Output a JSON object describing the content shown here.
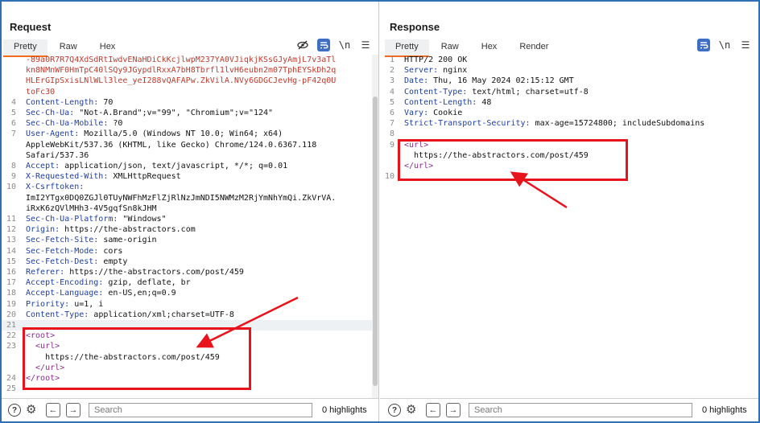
{
  "request": {
    "title": "Request",
    "tabs": [
      "Pretty",
      "Raw",
      "Hex"
    ],
    "active_tab": "Pretty",
    "toolbar_icons": [
      "eye-slash-icon",
      "wrap-lines-icon",
      "newline-icon",
      "menu-icon"
    ],
    "lines": [
      {
        "n": "",
        "parts": [
          {
            "t": "-89a0R7R7Q4XdSdRtIwdvENaHDiCkKcjlwpM237YA0VJiqkjKSsGJyAmjL7v3aTl",
            "c": "red"
          }
        ]
      },
      {
        "n": "",
        "parts": [
          {
            "t": "kn8NMnWF0HmTpC40lSQy9JGypdlRxxA7bH8Tbrfl1lvH6eubn2m07TphEYSkDh2q",
            "c": "red"
          }
        ]
      },
      {
        "n": "",
        "parts": [
          {
            "t": "HLErGIpSxisLNlWLl3lee_yeI288vQAFAPw.ZkVilA.NVy6GDGCJevHg-pF42q0U",
            "c": "red"
          }
        ]
      },
      {
        "n": "",
        "parts": [
          {
            "t": "toFc30",
            "c": "red"
          }
        ]
      },
      {
        "n": "4",
        "parts": [
          {
            "t": "Content-Length:",
            "c": "hn"
          },
          {
            "t": " 70",
            "c": ""
          }
        ]
      },
      {
        "n": "5",
        "parts": [
          {
            "t": "Sec-Ch-Ua:",
            "c": "hn"
          },
          {
            "t": " \"Not-A.Brand\";v=\"99\", \"Chromium\";v=\"124\"",
            "c": ""
          }
        ]
      },
      {
        "n": "6",
        "parts": [
          {
            "t": "Sec-Ch-Ua-Mobile:",
            "c": "hn"
          },
          {
            "t": " ?0",
            "c": ""
          }
        ]
      },
      {
        "n": "7",
        "parts": [
          {
            "t": "User-Agent:",
            "c": "hn"
          },
          {
            "t": " Mozilla/5.0 (Windows NT 10.0; Win64; x64)",
            "c": ""
          }
        ]
      },
      {
        "n": "",
        "parts": [
          {
            "t": "AppleWebKit/537.36 (KHTML, like Gecko) Chrome/124.0.6367.118",
            "c": ""
          }
        ]
      },
      {
        "n": "",
        "parts": [
          {
            "t": "Safari/537.36",
            "c": ""
          }
        ]
      },
      {
        "n": "8",
        "parts": [
          {
            "t": "Accept:",
            "c": "hn"
          },
          {
            "t": " application/json, text/javascript, */*; q=0.01",
            "c": ""
          }
        ]
      },
      {
        "n": "9",
        "parts": [
          {
            "t": "X-Requested-With:",
            "c": "hn"
          },
          {
            "t": " XMLHttpRequest",
            "c": ""
          }
        ]
      },
      {
        "n": "10",
        "parts": [
          {
            "t": "X-Csrftoken:",
            "c": "hn"
          }
        ]
      },
      {
        "n": "",
        "parts": [
          {
            "t": "ImI2YTgx0DQ0ZGJl0TUyNWFhMzFlZjRlNzJmNDI5NWMzM2RjYmNhYmQi.ZkVrVA.",
            "c": ""
          }
        ]
      },
      {
        "n": "",
        "parts": [
          {
            "t": "iRxK6zQVlMHh3-4V5gqfSn8kJHM",
            "c": ""
          }
        ]
      },
      {
        "n": "11",
        "parts": [
          {
            "t": "Sec-Ch-Ua-Platform:",
            "c": "hn"
          },
          {
            "t": " \"Windows\"",
            "c": ""
          }
        ]
      },
      {
        "n": "12",
        "parts": [
          {
            "t": "Origin:",
            "c": "hn"
          },
          {
            "t": " https://the-abstractors.com",
            "c": ""
          }
        ]
      },
      {
        "n": "13",
        "parts": [
          {
            "t": "Sec-Fetch-Site:",
            "c": "hn"
          },
          {
            "t": " same-origin",
            "c": ""
          }
        ]
      },
      {
        "n": "14",
        "parts": [
          {
            "t": "Sec-Fetch-Mode:",
            "c": "hn"
          },
          {
            "t": " cors",
            "c": ""
          }
        ]
      },
      {
        "n": "15",
        "parts": [
          {
            "t": "Sec-Fetch-Dest:",
            "c": "hn"
          },
          {
            "t": " empty",
            "c": ""
          }
        ]
      },
      {
        "n": "16",
        "parts": [
          {
            "t": "Referer:",
            "c": "hn"
          },
          {
            "t": " https://the-abstractors.com/post/459",
            "c": ""
          }
        ]
      },
      {
        "n": "17",
        "parts": [
          {
            "t": "Accept-Encoding:",
            "c": "hn"
          },
          {
            "t": " gzip, deflate, br",
            "c": ""
          }
        ]
      },
      {
        "n": "18",
        "parts": [
          {
            "t": "Accept-Language:",
            "c": "hn"
          },
          {
            "t": " en-US,en;q=0.9",
            "c": ""
          }
        ]
      },
      {
        "n": "19",
        "parts": [
          {
            "t": "Priority:",
            "c": "hn"
          },
          {
            "t": " u=1, i",
            "c": ""
          }
        ]
      },
      {
        "n": "20",
        "parts": [
          {
            "t": "Content-Type:",
            "c": "hn"
          },
          {
            "t": " application/xml;charset=UTF-8",
            "c": ""
          }
        ]
      },
      {
        "n": "21",
        "parts": [
          {
            "t": "",
            "c": ""
          }
        ],
        "hl": true
      },
      {
        "n": "22",
        "parts": [
          {
            "t": "<root>",
            "c": "tag"
          }
        ]
      },
      {
        "n": "23",
        "parts": [
          {
            "t": "  <url>",
            "c": "tag"
          }
        ]
      },
      {
        "n": "",
        "parts": [
          {
            "t": "    https://the-abstractors.com/post/459",
            "c": ""
          }
        ]
      },
      {
        "n": "",
        "parts": [
          {
            "t": "  </url>",
            "c": "tag"
          }
        ]
      },
      {
        "n": "24",
        "parts": [
          {
            "t": "</root>",
            "c": "tag"
          }
        ]
      },
      {
        "n": "25",
        "parts": [
          {
            "t": "",
            "c": ""
          }
        ]
      }
    ],
    "search_placeholder": "Search",
    "highlights": "0 highlights"
  },
  "response": {
    "title": "Response",
    "tabs": [
      "Pretty",
      "Raw",
      "Hex",
      "Render"
    ],
    "active_tab": "Pretty",
    "toolbar_icons": [
      "wrap-lines-icon",
      "newline-icon",
      "menu-icon"
    ],
    "lines": [
      {
        "n": "1",
        "parts": [
          {
            "t": "HTTP/2 200 OK",
            "c": ""
          }
        ]
      },
      {
        "n": "2",
        "parts": [
          {
            "t": "Server:",
            "c": "hn"
          },
          {
            "t": " nginx",
            "c": ""
          }
        ]
      },
      {
        "n": "3",
        "parts": [
          {
            "t": "Date:",
            "c": "hn"
          },
          {
            "t": " Thu, 16 May 2024 02:15:12 GMT",
            "c": ""
          }
        ]
      },
      {
        "n": "4",
        "parts": [
          {
            "t": "Content-Type:",
            "c": "hn"
          },
          {
            "t": " text/html; charset=utf-8",
            "c": ""
          }
        ]
      },
      {
        "n": "5",
        "parts": [
          {
            "t": "Content-Length:",
            "c": "hn"
          },
          {
            "t": " 48",
            "c": ""
          }
        ]
      },
      {
        "n": "6",
        "parts": [
          {
            "t": "Vary:",
            "c": "hn"
          },
          {
            "t": " Cookie",
            "c": ""
          }
        ]
      },
      {
        "n": "7",
        "parts": [
          {
            "t": "Strict-Transport-Security:",
            "c": "hn"
          },
          {
            "t": " max-age=15724800; includeSubdomains",
            "c": ""
          }
        ]
      },
      {
        "n": "8",
        "parts": [
          {
            "t": "",
            "c": ""
          }
        ]
      },
      {
        "n": "9",
        "parts": [
          {
            "t": "<url>",
            "c": "tag"
          }
        ]
      },
      {
        "n": "",
        "parts": [
          {
            "t": "  https://the-abstractors.com/post/459",
            "c": ""
          }
        ]
      },
      {
        "n": "",
        "parts": [
          {
            "t": "</url>",
            "c": "tag"
          }
        ]
      },
      {
        "n": "10",
        "parts": [
          {
            "t": "",
            "c": ""
          }
        ]
      }
    ],
    "search_placeholder": "Search",
    "highlights": "0 highlights"
  },
  "layout_buttons": [
    "split-horizontal-icon",
    "split-vertical-icon",
    "single-pane-icon"
  ],
  "colors": {
    "header_name": "#1d3fa3",
    "xml_tag": "#8a2c8a",
    "token": "#c0392b",
    "annotation": "#e8131b",
    "accent": "#f26b21"
  }
}
